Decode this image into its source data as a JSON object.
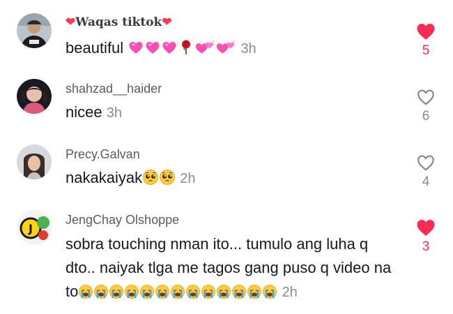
{
  "colors": {
    "accent": "#fe2c55",
    "muted": "#8a8b91",
    "text": "#161823"
  },
  "comments": [
    {
      "username": "Waqas tiktok",
      "text": "beautiful",
      "time": "3h",
      "likes": "5",
      "liked": true,
      "emojis": [
        "pink-heart",
        "pink-heart",
        "pink-heart",
        "rose",
        "two-hearts",
        "two-hearts"
      ]
    },
    {
      "username": "shahzad__haider",
      "text": "nicee",
      "time": "3h",
      "likes": "6",
      "liked": false
    },
    {
      "username": "Precy.Galvan",
      "text": "nakakaiyak",
      "time": "2h",
      "likes": "4",
      "liked": false,
      "emojis": [
        "pleading-face",
        "pleading-face"
      ]
    },
    {
      "username": "JengChay Olshoppe",
      "text": "sobra touching nman ito... tumulo ang luha q dto.. naiyak tlga me tagos gang puso q video na to",
      "time": "2h",
      "likes": "3",
      "liked": true,
      "emojis": [
        "loudly-crying-face",
        "loudly-crying-face",
        "loudly-crying-face",
        "loudly-crying-face",
        "loudly-crying-face",
        "loudly-crying-face",
        "loudly-crying-face",
        "loudly-crying-face",
        "loudly-crying-face",
        "loudly-crying-face",
        "loudly-crying-face",
        "loudly-crying-face",
        "loudly-crying-face"
      ]
    }
  ]
}
